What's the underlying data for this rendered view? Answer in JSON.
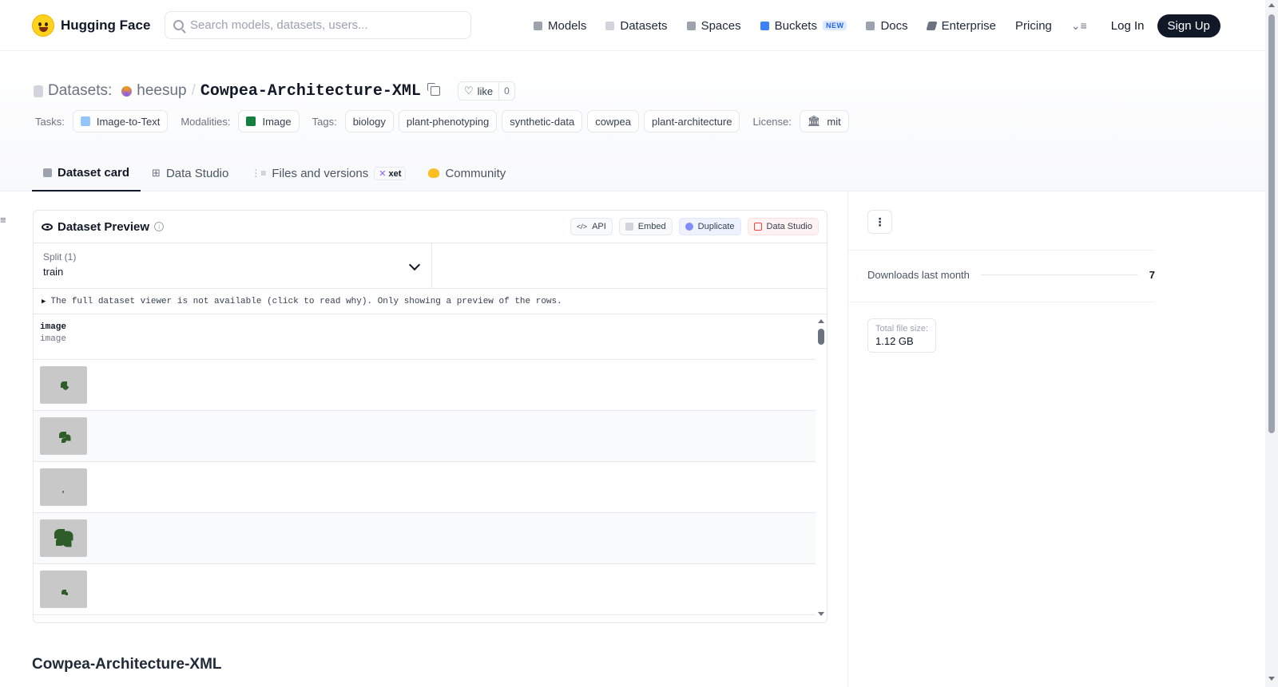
{
  "header": {
    "brand": "Hugging Face",
    "search_placeholder": "Search models, datasets, users...",
    "nav": [
      {
        "label": "Models",
        "icon": "models-icon",
        "color": "#9ca3af"
      },
      {
        "label": "Datasets",
        "icon": "datasets-icon",
        "color": "#d1d5db"
      },
      {
        "label": "Spaces",
        "icon": "spaces-icon",
        "color": "#9ca3af"
      },
      {
        "label": "Buckets",
        "icon": "buckets-icon",
        "color": "#3b82f6",
        "badge": "NEW"
      },
      {
        "label": "Docs",
        "icon": "docs-icon",
        "color": "#9ca3af"
      },
      {
        "label": "Enterprise",
        "icon": "enterprise-icon",
        "color": "#6b7280"
      },
      {
        "label": "Pricing"
      }
    ],
    "more_glyph": "⌄≡",
    "login": "Log In",
    "signup": "Sign Up"
  },
  "repo": {
    "type_label": "Datasets:",
    "owner": "heesup",
    "separator": "/",
    "name": "Cowpea-Architecture-XML",
    "like_label": "like",
    "like_count": "0"
  },
  "tags": {
    "tasks_label": "Tasks:",
    "tasks": [
      "Image-to-Text"
    ],
    "modalities_label": "Modalities:",
    "modalities": [
      "Image"
    ],
    "tags_label": "Tags:",
    "tags": [
      "biology",
      "plant-phenotyping",
      "synthetic-data",
      "cowpea",
      "plant-architecture"
    ],
    "license_label": "License:",
    "license": "mit"
  },
  "tabs": [
    {
      "label": "Dataset card",
      "active": true
    },
    {
      "label": "Data Studio"
    },
    {
      "label": "Files and versions",
      "badge": "xet"
    },
    {
      "label": "Community"
    }
  ],
  "preview": {
    "title": "Dataset Preview",
    "actions": {
      "api": "API",
      "embed": "Embed",
      "duplicate": "Duplicate",
      "studio": "Data Studio"
    },
    "split_label": "Split (1)",
    "split_value": "train",
    "notice": "The full dataset viewer is not available (click to read why). Only showing a preview of the rows.",
    "column": {
      "name": "image",
      "type": "image"
    },
    "row_count": 5
  },
  "sidebar": {
    "downloads_label": "Downloads last month",
    "downloads_value": "7",
    "size_label": "Total file size:",
    "size_value": "1.12 GB"
  },
  "readme": {
    "title": "Cowpea-Architecture-XML"
  }
}
